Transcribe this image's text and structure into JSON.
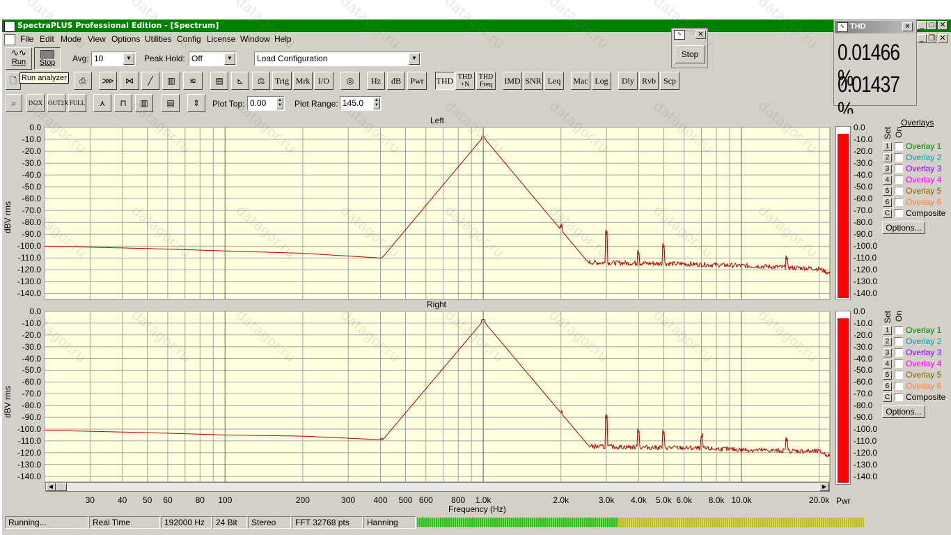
{
  "window": {
    "title": "SpectraPLUS Professional Edition - [Spectrum]"
  },
  "menu": [
    "File",
    "Edit",
    "Mode",
    "View",
    "Options",
    "Utilities",
    "Config",
    "License",
    "Window",
    "Help"
  ],
  "toolbar1": {
    "run_label": "Run",
    "stop_label": "Stop",
    "tooltip": "Run analyzer",
    "avg_label": "Avg:",
    "avg_value": "10",
    "peak_hold_label": "Peak Hold:",
    "peak_hold_value": "Off",
    "config_value": "Load Configuration"
  },
  "toolbar2": [
    "Trig",
    "Mrk",
    "I/O",
    "Hz",
    "dB",
    "Pwr",
    "THD",
    "THD +N",
    "THD Freq",
    "IMD",
    "SNR",
    "Leq",
    "Mac",
    "Log",
    "Dly",
    "Rvb",
    "Scp"
  ],
  "toolbar3": {
    "plot_top_label": "Plot Top:",
    "plot_top_value": "0.00",
    "plot_range_label": "Plot Range:",
    "plot_range_value": "145.0"
  },
  "mini_window": {
    "stop_label": "Stop"
  },
  "thd_window": {
    "title": "THD",
    "value1": "0.01466 %",
    "value2": "0.01437 %"
  },
  "plots": {
    "left_title": "Left",
    "right_title": "Right",
    "ylabel": "dBV rms",
    "xlabel": "Frequency (Hz)",
    "yticks": [
      "0.0",
      "-10.0",
      "-20.0",
      "-30.0",
      "-40.0",
      "-50.0",
      "-60.0",
      "-70.0",
      "-80.0",
      "-90.0",
      "-100.0",
      "-110.0",
      "-120.0",
      "-130.0",
      "-140.0"
    ],
    "xticks": [
      "30",
      "40",
      "50",
      "60",
      "80",
      "100",
      "200",
      "300",
      "400",
      "500",
      "600",
      "800",
      "1.0k",
      "2.0k",
      "3.0k",
      "4.0k",
      "5.0k",
      "6.0k",
      "8.0k",
      "10.0k",
      "20.0k"
    ],
    "pwr_label": "Pwr"
  },
  "overlays": {
    "title": "Overlays",
    "set_label": "Set",
    "on_label": "On",
    "items": [
      {
        "num": "1",
        "label": "Overlay 1",
        "color": "#008000"
      },
      {
        "num": "2",
        "label": "Overlay 2",
        "color": "#00a0a0"
      },
      {
        "num": "3",
        "label": "Overlay 3",
        "color": "#8000ff"
      },
      {
        "num": "4",
        "label": "Overlay 4",
        "color": "#ff00ff"
      },
      {
        "num": "5",
        "label": "Overlay 5",
        "color": "#806000"
      },
      {
        "num": "6",
        "label": "Overlay 6",
        "color": "#ff8040"
      },
      {
        "num": "C",
        "label": "Composite",
        "color": "#000000"
      }
    ],
    "options_label": "Options..."
  },
  "status": {
    "state": "Running...",
    "mode": "Real Time",
    "rate": "192000 Hz",
    "bits": "24 Bit",
    "channels": "Stereo",
    "fft": "FFT 32768 pts",
    "window": "Hanning"
  },
  "watermark": "datagor.ru",
  "chart_data": {
    "type": "line",
    "xscale": "log",
    "xlim": [
      20,
      22000
    ],
    "ylim": [
      -145,
      0
    ],
    "xlabel": "Frequency (Hz)",
    "ylabel": "dBV rms",
    "series": [
      {
        "name": "Left",
        "peaks": [
          [
            1000,
            -8
          ],
          [
            2000,
            -85
          ],
          [
            3000,
            -90
          ],
          [
            5000,
            -102
          ],
          [
            500,
            -103
          ],
          [
            650,
            -102
          ],
          [
            800,
            -97
          ],
          [
            1100,
            -96
          ],
          [
            1200,
            -103
          ],
          [
            1300,
            -104
          ],
          [
            1500,
            -106
          ],
          [
            1700,
            -106
          ],
          [
            4000,
            -108
          ],
          [
            15000,
            -112
          ]
        ],
        "noise": [
          [
            20,
            -100
          ],
          [
            50,
            -102
          ],
          [
            100,
            -104
          ],
          [
            200,
            -106
          ],
          [
            400,
            -110
          ],
          [
            700,
            -112
          ],
          [
            1500,
            -113
          ],
          [
            3000,
            -114
          ],
          [
            6000,
            -115
          ],
          [
            12000,
            -117
          ],
          [
            20000,
            -119
          ],
          [
            22000,
            -123
          ]
        ]
      },
      {
        "name": "Right",
        "peaks": [
          [
            1000,
            -7
          ],
          [
            2000,
            -88
          ],
          [
            3000,
            -91
          ],
          [
            4000,
            -104
          ],
          [
            5000,
            -105
          ],
          [
            7000,
            -108
          ],
          [
            500,
            -104
          ],
          [
            650,
            -105
          ],
          [
            800,
            -97
          ],
          [
            1100,
            -94
          ],
          [
            1200,
            -103
          ],
          [
            1500,
            -107
          ],
          [
            15000,
            -111
          ]
        ],
        "noise": [
          [
            20,
            -101
          ],
          [
            50,
            -103
          ],
          [
            100,
            -105
          ],
          [
            200,
            -106
          ],
          [
            400,
            -109
          ],
          [
            700,
            -112
          ],
          [
            1500,
            -114
          ],
          [
            3000,
            -115
          ],
          [
            6000,
            -116
          ],
          [
            12000,
            -118
          ],
          [
            20000,
            -119
          ],
          [
            22000,
            -123
          ]
        ]
      }
    ]
  }
}
